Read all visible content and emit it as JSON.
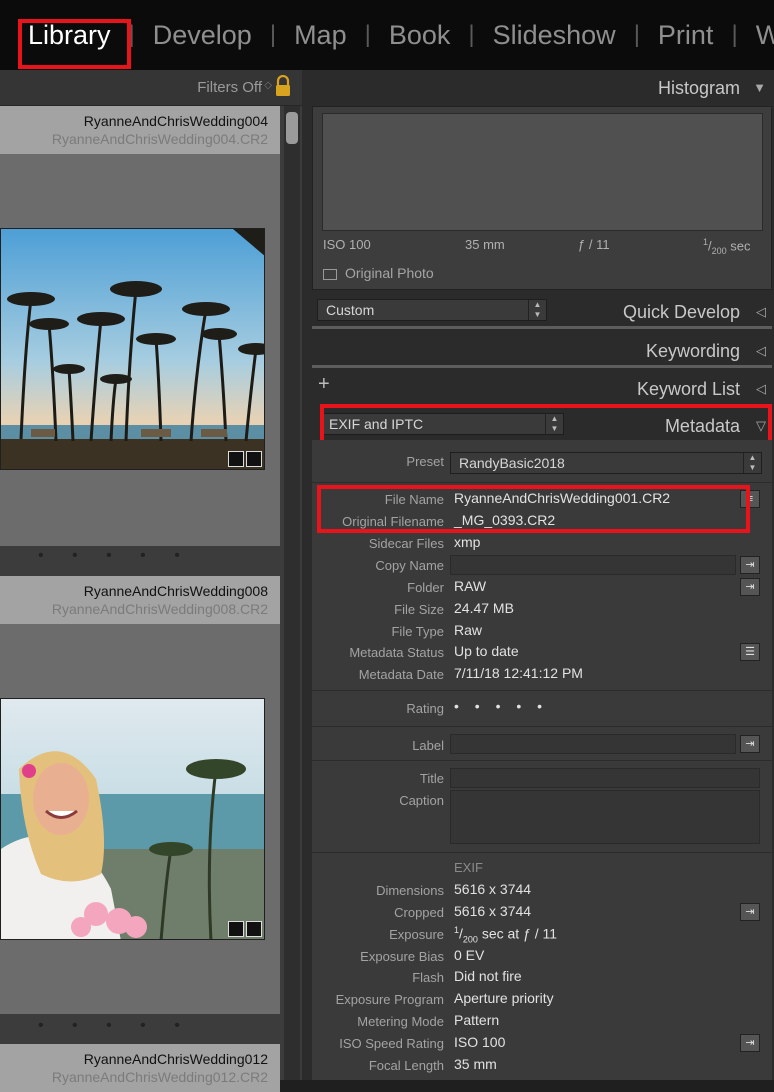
{
  "modules": [
    {
      "label": "Library",
      "active": true
    },
    {
      "label": "Develop",
      "active": false
    },
    {
      "label": "Map",
      "active": false
    },
    {
      "label": "Book",
      "active": false
    },
    {
      "label": "Slideshow",
      "active": false
    },
    {
      "label": "Print",
      "active": false
    },
    {
      "label": "We",
      "active": false
    }
  ],
  "module_separator": "|",
  "filter_bar": {
    "label": "Filters Off",
    "lock_icon": "lock-icon"
  },
  "grid": [
    {
      "name": "RyanneAndChrisWedding004",
      "file": "RyanneAndChrisWedding004.CR2",
      "image": "palm-trees-beach-sunset",
      "rating_dots": "• • • • •"
    },
    {
      "name": "RyanneAndChrisWedding008",
      "file": "RyanneAndChrisWedding008.CR2",
      "image": "bride-portrait-beach",
      "rating_dots": "• • • • •"
    },
    {
      "name": "RyanneAndChrisWedding012",
      "file": "RyanneAndChrisWedding012.CR2"
    }
  ],
  "histogram": {
    "title": "Histogram",
    "iso": "ISO 100",
    "focal": "35 mm",
    "aperture": "ƒ / 11",
    "shutter_num": "1",
    "shutter_den": "200",
    "shutter_unit": "sec",
    "original_photo": "Original Photo"
  },
  "quick_develop": {
    "title": "Quick Develop",
    "preset": "Custom"
  },
  "keywording": {
    "title": "Keywording"
  },
  "keyword_list": {
    "title": "Keyword List",
    "add": "+"
  },
  "metadata": {
    "title": "Metadata",
    "view": "EXIF and IPTC",
    "preset_label": "Preset",
    "preset_value": "RandyBasic2018",
    "fields": {
      "file_name": {
        "label": "File Name",
        "value": "RyanneAndChrisWedding001.CR2"
      },
      "original_filename": {
        "label": "Original Filename",
        "value": "_MG_0393.CR2"
      },
      "sidecar": {
        "label": "Sidecar Files",
        "value": "xmp"
      },
      "copy_name": {
        "label": "Copy Name",
        "value": ""
      },
      "folder": {
        "label": "Folder",
        "value": "RAW"
      },
      "file_size": {
        "label": "File Size",
        "value": "24.47 MB"
      },
      "file_type": {
        "label": "File Type",
        "value": "Raw"
      },
      "metadata_status": {
        "label": "Metadata Status",
        "value": "Up to date"
      },
      "metadata_date": {
        "label": "Metadata Date",
        "value": "7/11/18 12:41:12 PM"
      },
      "rating": {
        "label": "Rating",
        "value": "• • • • •"
      },
      "label": {
        "label": "Label",
        "value": ""
      },
      "title": {
        "label": "Title",
        "value": ""
      },
      "caption": {
        "label": "Caption",
        "value": ""
      }
    },
    "exif_heading": "EXIF",
    "exif": {
      "dimensions": {
        "label": "Dimensions",
        "value": "5616 x 3744"
      },
      "cropped": {
        "label": "Cropped",
        "value": "5616 x 3744"
      },
      "exposure": {
        "label": "Exposure",
        "num": "1",
        "den": "200",
        "rest": " sec at ƒ / 11"
      },
      "exposure_bias": {
        "label": "Exposure Bias",
        "value": "0 EV"
      },
      "flash": {
        "label": "Flash",
        "value": "Did not fire"
      },
      "exposure_program": {
        "label": "Exposure Program",
        "value": "Aperture priority"
      },
      "metering_mode": {
        "label": "Metering Mode",
        "value": "Pattern"
      },
      "iso": {
        "label": "ISO Speed Rating",
        "value": "ISO 100"
      },
      "focal_length": {
        "label": "Focal Length",
        "value": "35 mm"
      }
    }
  },
  "colors": {
    "highlight": "#e8131b",
    "panel_bg": "#2b2b2b",
    "metadata_bg": "#3a3a3a",
    "topbar_bg": "#0b0b0b"
  }
}
